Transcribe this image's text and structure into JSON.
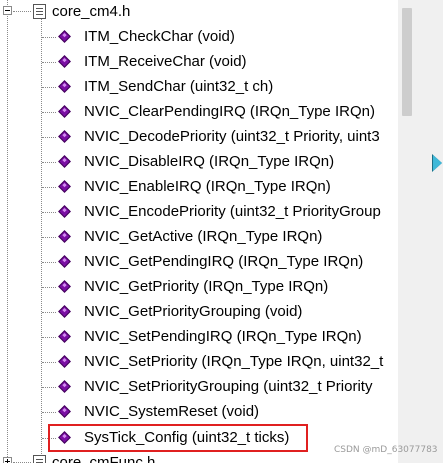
{
  "tree": {
    "root": {
      "label": "core_cm4.h",
      "expanded": true
    },
    "items": [
      {
        "label": "ITM_CheckChar (void)"
      },
      {
        "label": "ITM_ReceiveChar (void)"
      },
      {
        "label": "ITM_SendChar (uint32_t ch)"
      },
      {
        "label": "NVIC_ClearPendingIRQ (IRQn_Type IRQn)"
      },
      {
        "label": "NVIC_DecodePriority (uint32_t Priority, uint3"
      },
      {
        "label": "NVIC_DisableIRQ (IRQn_Type IRQn)"
      },
      {
        "label": "NVIC_EnableIRQ (IRQn_Type IRQn)"
      },
      {
        "label": "NVIC_EncodePriority (uint32_t PriorityGroup"
      },
      {
        "label": "NVIC_GetActive (IRQn_Type IRQn)"
      },
      {
        "label": "NVIC_GetPendingIRQ (IRQn_Type IRQn)"
      },
      {
        "label": "NVIC_GetPriority (IRQn_Type IRQn)"
      },
      {
        "label": "NVIC_GetPriorityGrouping (void)"
      },
      {
        "label": "NVIC_SetPendingIRQ (IRQn_Type IRQn)"
      },
      {
        "label": "NVIC_SetPriority (IRQn_Type IRQn, uint32_t"
      },
      {
        "label": "NVIC_SetPriorityGrouping (uint32_t Priority"
      },
      {
        "label": "NVIC_SystemReset (void)"
      },
      {
        "label": "SysTick_Config (uint32_t ticks)"
      }
    ],
    "next_root": {
      "label": "core_cmFunc.h",
      "expanded": false
    }
  },
  "icons": {
    "function_icon": "purple-diamond-icon",
    "file_icon": "header-file-icon"
  },
  "colors": {
    "function_icon": "#7a0fa3",
    "highlight_border": "#e02020",
    "panel_arrow": "#3fb8d8"
  },
  "watermark": "CSDN @mD_63077783"
}
